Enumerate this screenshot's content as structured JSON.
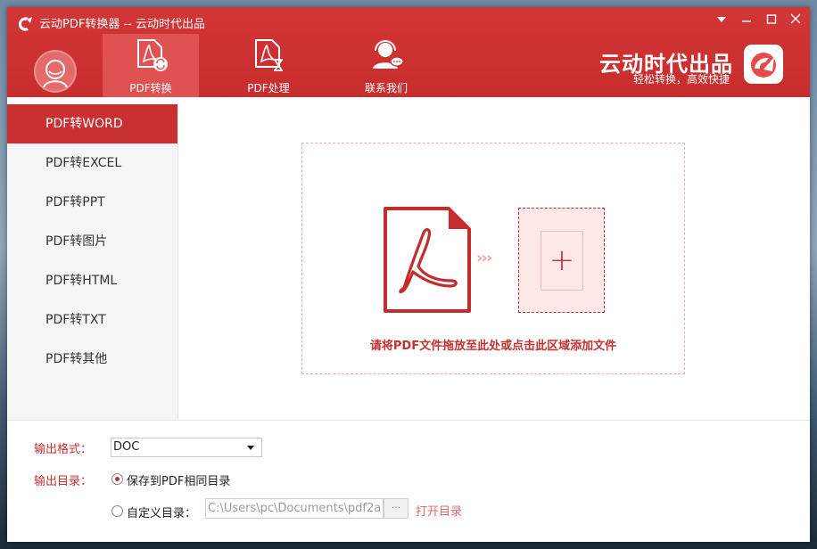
{
  "window": {
    "title": "云动PDF转换器 -- 云动时代出品",
    "controls": [
      "dropdown-icon",
      "minimize-icon",
      "maximize-icon",
      "close-icon"
    ]
  },
  "header": {
    "tabs": [
      {
        "label": "PDF转换",
        "icon": "pdf-convert-icon",
        "active": true
      },
      {
        "label": "PDF处理",
        "icon": "pdf-process-icon",
        "active": false
      },
      {
        "label": "联系我们",
        "icon": "contact-support-icon",
        "active": false
      }
    ],
    "brand": {
      "name": "云动时代出品",
      "slogan": "轻松转换，高效快捷"
    }
  },
  "sidebar": {
    "items": [
      {
        "label": "PDF转WORD",
        "active": true
      },
      {
        "label": "PDF转EXCEL",
        "active": false
      },
      {
        "label": "PDF转PPT",
        "active": false
      },
      {
        "label": "PDF转图片",
        "active": false
      },
      {
        "label": "PDF转HTML",
        "active": false
      },
      {
        "label": "PDF转TXT",
        "active": false
      },
      {
        "label": "PDF转其他",
        "active": false
      }
    ]
  },
  "main": {
    "drop_hint": "请将PDF文件拖放至此处或点击此区域添加文件",
    "arrows": "›››",
    "add_symbol": "+"
  },
  "bottom": {
    "format_label": "输出格式：",
    "format_value": "DOC",
    "dir_label": "输出目录：",
    "option_same": "保存到PDF相同目录",
    "option_custom": "自定义目录：",
    "custom_path": "C:\\Users\\pc\\Documents\\pdf2a",
    "browse_label": "···",
    "open_dir": "打开目录",
    "selected_option": "same"
  },
  "colors": {
    "brand_red": "#c82d2e",
    "active_tab": "#e05252",
    "accent_text": "#c6302f",
    "drop_border": "#f0a8a8"
  }
}
